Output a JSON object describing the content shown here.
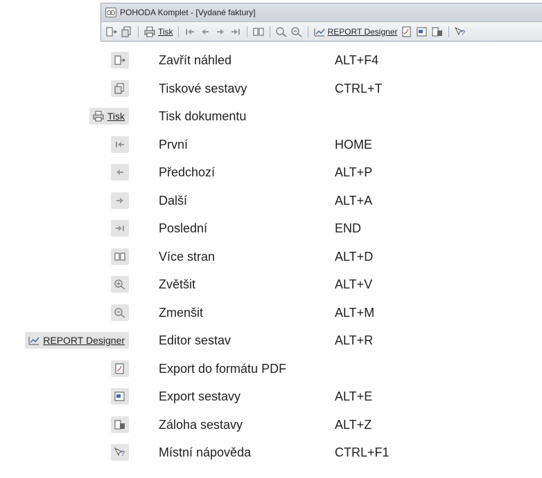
{
  "window": {
    "title": "POHODA Komplet - [Vydané faktury]"
  },
  "toolbar": {
    "print_label": "Tisk",
    "report_label": "REPORT Designer"
  },
  "rows": [
    {
      "icon": "close-preview-icon",
      "label": "Zavřít náhled",
      "shortcut": "ALT+F4"
    },
    {
      "icon": "print-reports-icon",
      "label": "Tiskové sestavy",
      "shortcut": "CTRL+T"
    },
    {
      "icon": "printer-icon",
      "button_text": "Tisk",
      "label": "Tisk dokumentu",
      "shortcut": ""
    },
    {
      "icon": "first-page-icon",
      "label": "První",
      "shortcut": "HOME"
    },
    {
      "icon": "previous-page-icon",
      "label": "Předchozí",
      "shortcut": "ALT+P"
    },
    {
      "icon": "next-page-icon",
      "label": "Další",
      "shortcut": "ALT+A"
    },
    {
      "icon": "last-page-icon",
      "label": "Poslední",
      "shortcut": "END"
    },
    {
      "icon": "multi-page-icon",
      "label": "Více stran",
      "shortcut": "ALT+D"
    },
    {
      "icon": "zoom-in-icon",
      "label": "Zvětšit",
      "shortcut": "ALT+V"
    },
    {
      "icon": "zoom-out-icon",
      "label": "Zmenšit",
      "shortcut": "ALT+M"
    },
    {
      "icon": "report-designer-icon",
      "button_text": "REPORT Designer",
      "label": "Editor sestav",
      "shortcut": "ALT+R"
    },
    {
      "icon": "pdf-export-icon",
      "label": "Export do formátu PDF",
      "shortcut": ""
    },
    {
      "icon": "export-report-icon",
      "label": "Export sestavy",
      "shortcut": "ALT+E"
    },
    {
      "icon": "backup-report-icon",
      "label": "Záloha sestavy",
      "shortcut": "ALT+Z"
    },
    {
      "icon": "help-icon",
      "label": "Místní nápověda",
      "shortcut": "CTRL+F1"
    }
  ]
}
